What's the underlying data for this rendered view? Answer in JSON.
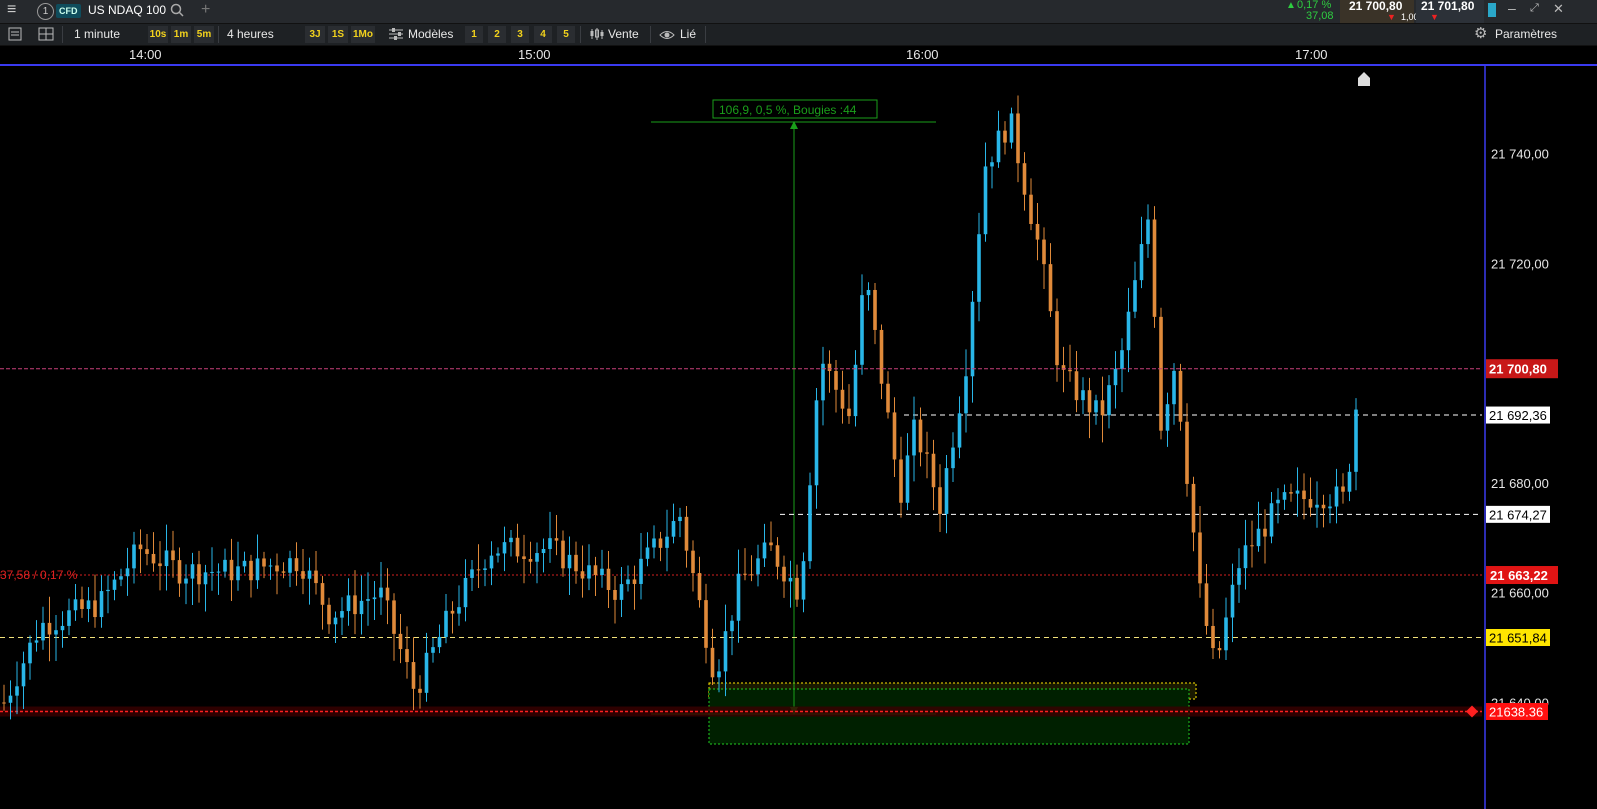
{
  "header": {
    "tab_number": "1",
    "asset_badge": "CFD",
    "instrument": "US NDAQ 100",
    "change_pct": "0,17 %",
    "change_abs": "37,08",
    "sell_price": "21 700,80",
    "spread": "1,00",
    "buy_price": "21 701,80"
  },
  "toolbar": {
    "interval": "1 minute",
    "quick_intervals": [
      "10s",
      "1m",
      "5m"
    ],
    "range": "4 heures",
    "quick_ranges": [
      "3J",
      "1S",
      "1Mo"
    ],
    "templates_label": "Modèles",
    "template_slots": [
      "1",
      "2",
      "3",
      "4",
      "5"
    ],
    "order_label": "Vente",
    "linked_label": "Lié",
    "settings_label": "Paramètres"
  },
  "time_axis": [
    "14:00",
    "15:00",
    "16:00",
    "17:00"
  ],
  "chart_data": {
    "type": "candlestick",
    "y_ticks": [
      "21 740,00",
      "21 720,00",
      "21 680,00",
      "21 660,00",
      "21 640,00"
    ],
    "ylim": [
      21628,
      21756
    ],
    "price_labels": {
      "current": "21 700,80",
      "dashed_upper": "21 692,36",
      "dashed_mid": "21 674,27",
      "red_line": "21 663,22",
      "yellow_line": "21 651,84",
      "alert": "21638.36"
    },
    "red_line_annotation": "37,58 / 0,17 %",
    "measure_label": "106,9, 0,5 %, Bougies :44",
    "colors": {
      "up": "#29b6e8",
      "down": "#e08a3a",
      "current": "#cc1111",
      "yellow": "#ffe600",
      "measure": "#1a9e1a"
    }
  }
}
